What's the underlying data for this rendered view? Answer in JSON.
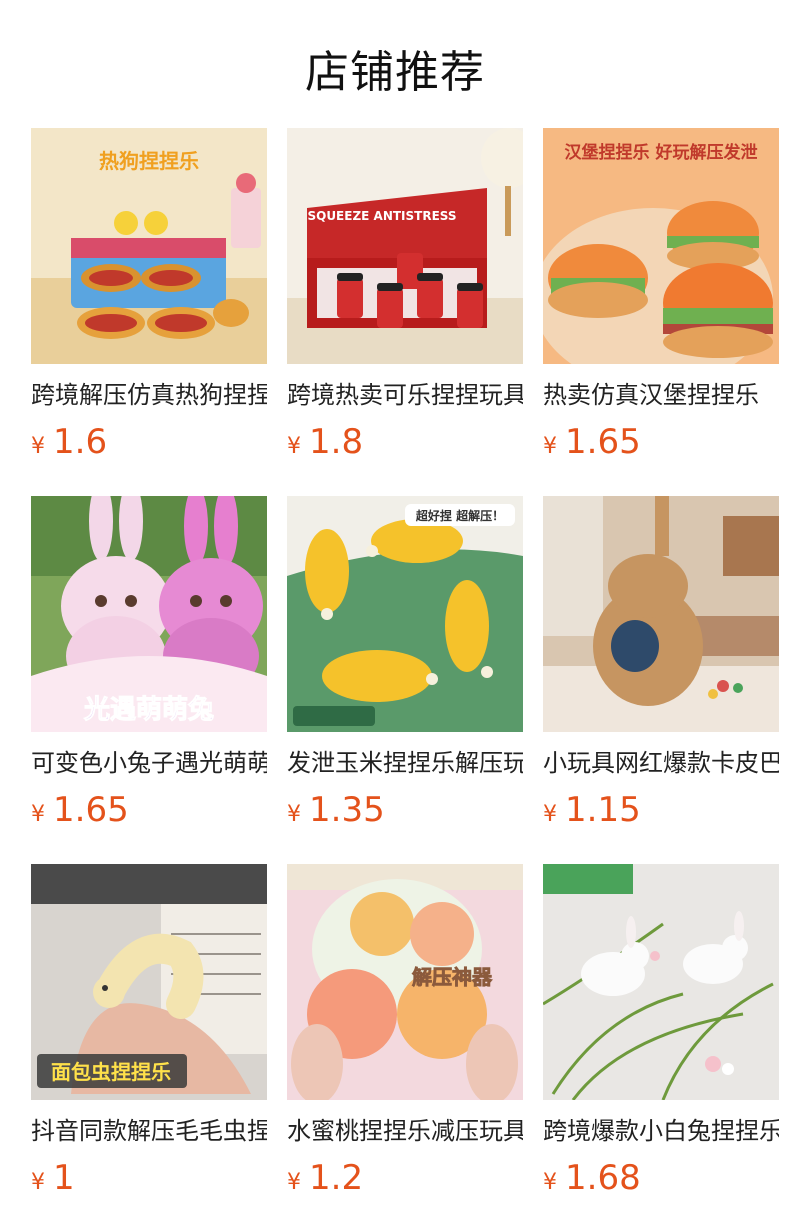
{
  "header": {
    "title": "店铺推荐"
  },
  "products": [
    {
      "name": "跨境解压仿真热狗捏捏乐",
      "currency": "¥",
      "price": "1.6",
      "image": "hotdog-toy-image",
      "overlay": "热狗捏捏乐"
    },
    {
      "name": "跨境热卖可乐捏捏玩具",
      "currency": "¥",
      "price": "1.8",
      "image": "soda-cup-toy-image",
      "overlay": "SQUEEZE ANTISTRESS"
    },
    {
      "name": "热卖仿真汉堡捏捏乐",
      "currency": "¥",
      "price": "1.65",
      "image": "hamburger-toy-image",
      "overlay": "汉堡捏捏乐 好玩解压发泄"
    },
    {
      "name": "可变色小兔子遇光萌萌兔",
      "currency": "¥",
      "price": "1.65",
      "image": "rabbit-toy-image",
      "overlay": "光遇萌萌兔"
    },
    {
      "name": "发泄玉米捏捏乐解压玩具",
      "currency": "¥",
      "price": "1.35",
      "image": "corn-toy-image",
      "overlay": "超好捏 超解压！"
    },
    {
      "name": "小玩具网红爆款卡皮巴拉",
      "currency": "¥",
      "price": "1.15",
      "image": "capybara-toy-image",
      "overlay": ""
    },
    {
      "name": "抖音同款解压毛毛虫捏捏乐",
      "currency": "¥",
      "price": "1",
      "image": "caterpillar-toy-image",
      "overlay": "面包虫捏捏乐"
    },
    {
      "name": "水蜜桃捏捏乐减压玩具",
      "currency": "¥",
      "price": "1.2",
      "image": "peach-toy-image",
      "overlay": "解压神器"
    },
    {
      "name": "跨境爆款小白兔捏捏乐",
      "currency": "¥",
      "price": "1.68",
      "image": "white-rabbit-toy-image",
      "overlay": ""
    }
  ],
  "colors": {
    "price": "#e4521b",
    "text": "#222222"
  }
}
